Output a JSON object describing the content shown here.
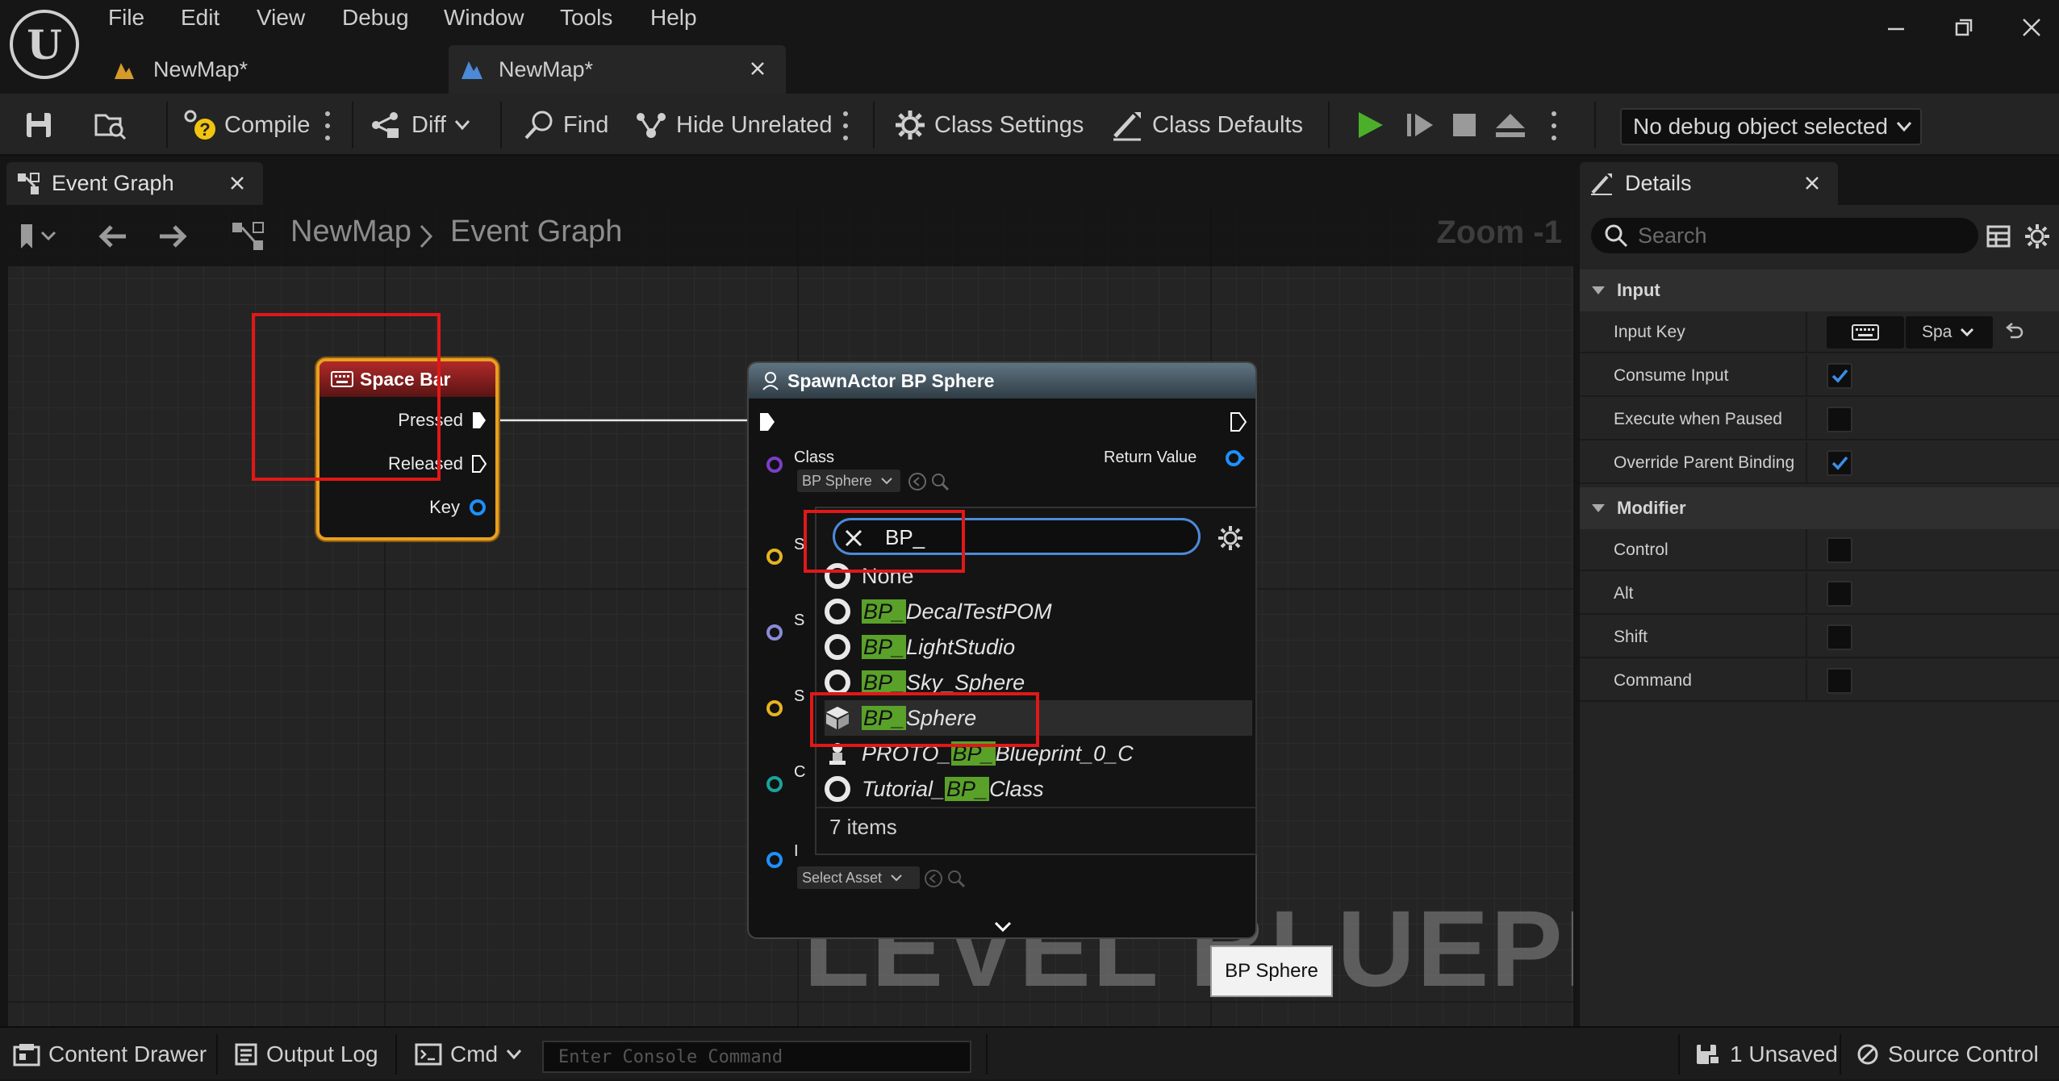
{
  "menu": [
    "File",
    "Edit",
    "View",
    "Debug",
    "Window",
    "Tools",
    "Help"
  ],
  "doc_tabs": [
    {
      "label": "NewMap*",
      "active": false
    },
    {
      "label": "NewMap*",
      "active": true
    }
  ],
  "toolbar": {
    "compile": "Compile",
    "diff": "Diff",
    "find": "Find",
    "hide_unrelated": "Hide Unrelated",
    "class_settings": "Class Settings",
    "class_defaults": "Class Defaults",
    "debug_object": "No debug object selected"
  },
  "graph_tab": {
    "label": "Event Graph"
  },
  "breadcrumb": {
    "root": "NewMap",
    "current": "Event Graph"
  },
  "zoom": "Zoom -1",
  "watermark": "LEVEL BLUEPRINT",
  "space_bar_node": {
    "title": "Space Bar",
    "pins": [
      "Pressed",
      "Released",
      "Key"
    ]
  },
  "spawn_node": {
    "title": "SpawnActor BP Sphere",
    "class_label": "Class",
    "class_value": "BP Sphere",
    "return_value": "Return Value",
    "select_asset": "Select Asset",
    "left_letters": [
      "S",
      "S",
      "S",
      "C",
      "I"
    ]
  },
  "picker": {
    "search_text": "BP_",
    "options": [
      {
        "pre": "",
        "match": "",
        "post": "None",
        "icon": "circle"
      },
      {
        "pre": "",
        "match": "BP_",
        "post": "DecalTestPOM",
        "icon": "circle"
      },
      {
        "pre": "",
        "match": "BP_",
        "post": "LightStudio",
        "icon": "circle"
      },
      {
        "pre": "",
        "match": "BP_",
        "post": "Sky_Sphere",
        "icon": "circle"
      },
      {
        "pre": "",
        "match": "BP_",
        "post": "Sphere",
        "icon": "cube"
      },
      {
        "pre": "PROTO_",
        "match": "BP_",
        "post": "Blueprint_0_C",
        "icon": "pawn"
      },
      {
        "pre": "Tutorial_",
        "match": "BP_",
        "post": "Class",
        "icon": "circle"
      }
    ],
    "count": "7 items"
  },
  "tooltip": "BP Sphere",
  "details": {
    "tab": "Details",
    "search_placeholder": "Search",
    "input_section": "Input",
    "input_key_label": "Input Key",
    "input_key_value": "Spa",
    "input_rows": [
      {
        "label": "Consume Input",
        "checked": true
      },
      {
        "label": "Execute when Paused",
        "checked": false
      },
      {
        "label": "Override Parent Binding",
        "checked": true
      }
    ],
    "modifier_section": "Modifier",
    "modifier_rows": [
      {
        "label": "Control",
        "checked": false
      },
      {
        "label": "Alt",
        "checked": false
      },
      {
        "label": "Shift",
        "checked": false
      },
      {
        "label": "Command",
        "checked": false
      }
    ]
  },
  "statusbar": {
    "content_drawer": "Content Drawer",
    "output_log": "Output Log",
    "cmd": "Cmd",
    "console_placeholder": "Enter Console Command",
    "unsaved": "1 Unsaved",
    "source_control": "Source Control"
  },
  "colors": {
    "accent_blue": "#4c8ad8",
    "play_green": "#4caf2a",
    "highlight_green": "#5aa12a",
    "annotation_red": "#e11818",
    "node_select_orange": "#e8a020"
  }
}
